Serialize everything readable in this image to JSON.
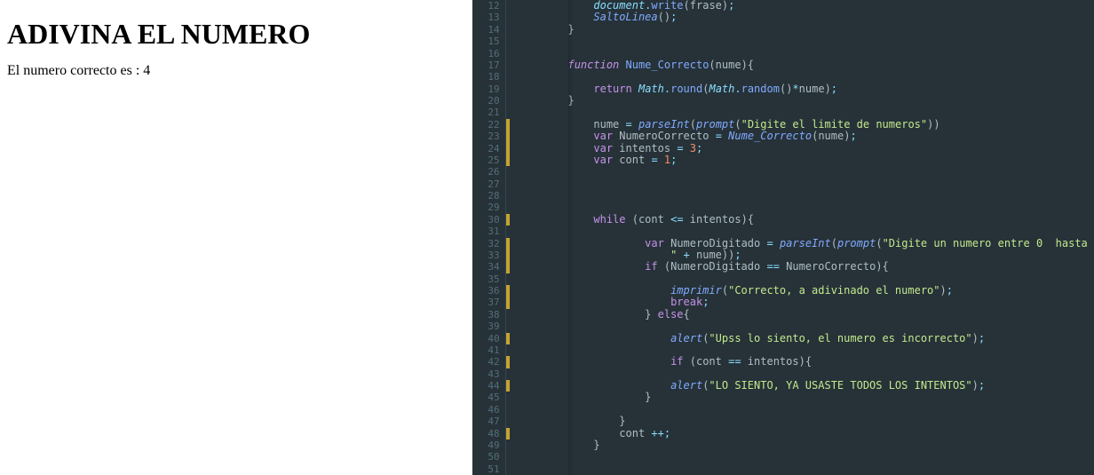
{
  "preview": {
    "heading": "ADIVINA EL NUMERO",
    "message": "El numero correcto es : 4"
  },
  "editor": {
    "first_line_number": 12,
    "modified_lines": [
      22,
      23,
      24,
      25,
      30,
      32,
      33,
      34,
      36,
      37,
      40,
      42,
      44,
      48
    ],
    "code_lines": [
      {
        "n": 12,
        "tokens": [
          [
            "            ",
            ""
          ],
          [
            "document",
            "obj"
          ],
          [
            ".",
            "op"
          ],
          [
            "write",
            "prop"
          ],
          [
            "(",
            "paren"
          ],
          [
            "frase",
            "ident"
          ],
          [
            ")",
            "paren"
          ],
          [
            ";",
            "punc"
          ]
        ]
      },
      {
        "n": 13,
        "tokens": [
          [
            "            ",
            ""
          ],
          [
            "SaltoLinea",
            "fn-it"
          ],
          [
            "()",
            "paren"
          ],
          [
            ";",
            "punc"
          ]
        ]
      },
      {
        "n": 14,
        "tokens": [
          [
            "        }",
            "ident"
          ]
        ]
      },
      {
        "n": 15,
        "tokens": [
          [
            "",
            ""
          ]
        ]
      },
      {
        "n": 16,
        "tokens": [
          [
            "",
            ""
          ]
        ]
      },
      {
        "n": 17,
        "tokens": [
          [
            "        ",
            ""
          ],
          [
            "function",
            "kw"
          ],
          [
            " ",
            ""
          ],
          [
            "Nume_Correcto",
            "fn"
          ],
          [
            "(",
            "paren"
          ],
          [
            "nume",
            "ident"
          ],
          [
            ")",
            "paren"
          ],
          [
            "{",
            "ident"
          ]
        ]
      },
      {
        "n": 18,
        "tokens": [
          [
            "",
            ""
          ]
        ]
      },
      {
        "n": 19,
        "tokens": [
          [
            "            ",
            ""
          ],
          [
            "return",
            "kw2"
          ],
          [
            " ",
            ""
          ],
          [
            "Math",
            "obj"
          ],
          [
            ".",
            "op"
          ],
          [
            "round",
            "prop"
          ],
          [
            "(",
            "paren"
          ],
          [
            "Math",
            "obj"
          ],
          [
            ".",
            "op"
          ],
          [
            "random",
            "prop"
          ],
          [
            "()",
            "paren"
          ],
          [
            "*",
            "op"
          ],
          [
            "nume",
            "ident"
          ],
          [
            ")",
            "paren"
          ],
          [
            ";",
            "punc"
          ]
        ]
      },
      {
        "n": 20,
        "tokens": [
          [
            "        }",
            "ident"
          ]
        ]
      },
      {
        "n": 21,
        "tokens": [
          [
            "",
            ""
          ]
        ]
      },
      {
        "n": 22,
        "tokens": [
          [
            "            ",
            ""
          ],
          [
            "nume",
            "ident"
          ],
          [
            " ",
            ""
          ],
          [
            "=",
            "op"
          ],
          [
            " ",
            ""
          ],
          [
            "parseInt",
            "fn-it"
          ],
          [
            "(",
            "paren"
          ],
          [
            "prompt",
            "fn-it"
          ],
          [
            "(",
            "paren"
          ],
          [
            "\"Digite el limite de numeros\"",
            "str"
          ],
          [
            "))",
            "paren"
          ]
        ]
      },
      {
        "n": 23,
        "tokens": [
          [
            "            ",
            ""
          ],
          [
            "var",
            "kw2"
          ],
          [
            " ",
            ""
          ],
          [
            "NumeroCorrecto",
            "ident"
          ],
          [
            " ",
            ""
          ],
          [
            "=",
            "op"
          ],
          [
            " ",
            ""
          ],
          [
            "Nume_Correcto",
            "fn-it"
          ],
          [
            "(",
            "paren"
          ],
          [
            "nume",
            "ident"
          ],
          [
            ")",
            "paren"
          ],
          [
            ";",
            "punc"
          ]
        ]
      },
      {
        "n": 24,
        "tokens": [
          [
            "            ",
            ""
          ],
          [
            "var",
            "kw2"
          ],
          [
            " ",
            ""
          ],
          [
            "intentos",
            "ident"
          ],
          [
            " ",
            ""
          ],
          [
            "=",
            "op"
          ],
          [
            " ",
            ""
          ],
          [
            "3",
            "num"
          ],
          [
            ";",
            "punc"
          ]
        ]
      },
      {
        "n": 25,
        "tokens": [
          [
            "            ",
            ""
          ],
          [
            "var",
            "kw2"
          ],
          [
            " ",
            ""
          ],
          [
            "cont",
            "ident"
          ],
          [
            " ",
            ""
          ],
          [
            "=",
            "op"
          ],
          [
            " ",
            ""
          ],
          [
            "1",
            "num"
          ],
          [
            ";",
            "punc"
          ]
        ]
      },
      {
        "n": 26,
        "tokens": [
          [
            "",
            ""
          ]
        ]
      },
      {
        "n": 27,
        "tokens": [
          [
            "",
            ""
          ]
        ]
      },
      {
        "n": 28,
        "tokens": [
          [
            "",
            ""
          ]
        ]
      },
      {
        "n": 29,
        "tokens": [
          [
            "",
            ""
          ]
        ]
      },
      {
        "n": 30,
        "tokens": [
          [
            "            ",
            ""
          ],
          [
            "while",
            "kw2"
          ],
          [
            " (",
            "paren"
          ],
          [
            "cont",
            "ident"
          ],
          [
            " ",
            ""
          ],
          [
            "<=",
            "op"
          ],
          [
            " ",
            ""
          ],
          [
            "intentos",
            "ident"
          ],
          [
            "){",
            "ident"
          ]
        ]
      },
      {
        "n": 31,
        "tokens": [
          [
            "",
            ""
          ]
        ]
      },
      {
        "n": 32,
        "tokens": [
          [
            "                    ",
            ""
          ],
          [
            "var",
            "kw2"
          ],
          [
            " ",
            ""
          ],
          [
            "NumeroDigitado",
            "ident"
          ],
          [
            " ",
            ""
          ],
          [
            "=",
            "op"
          ],
          [
            " ",
            ""
          ],
          [
            "parseInt",
            "fn-it"
          ],
          [
            "(",
            "paren"
          ],
          [
            "prompt",
            "fn-it"
          ],
          [
            "(",
            "paren"
          ],
          [
            "\"Digite un numero entre 0  hasta ",
            "str"
          ]
        ]
      },
      {
        "n": 33,
        "tokens": [
          [
            "                        ",
            ""
          ],
          [
            "\"",
            "str"
          ],
          [
            " ",
            ""
          ],
          [
            "+",
            "op"
          ],
          [
            " ",
            ""
          ],
          [
            "nume",
            "ident"
          ],
          [
            "))",
            "paren"
          ],
          [
            ";",
            "punc"
          ]
        ]
      },
      {
        "n": 34,
        "tokens": [
          [
            "                    ",
            ""
          ],
          [
            "if",
            "kw2"
          ],
          [
            " (",
            "paren"
          ],
          [
            "NumeroDigitado",
            "ident"
          ],
          [
            " ",
            ""
          ],
          [
            "==",
            "op"
          ],
          [
            " ",
            ""
          ],
          [
            "NumeroCorrecto",
            "ident"
          ],
          [
            "){",
            "ident"
          ]
        ]
      },
      {
        "n": 35,
        "tokens": [
          [
            "",
            ""
          ]
        ]
      },
      {
        "n": 36,
        "tokens": [
          [
            "                        ",
            ""
          ],
          [
            "imprimir",
            "fn-it"
          ],
          [
            "(",
            "paren"
          ],
          [
            "\"Correcto, a adivinado el numero\"",
            "str"
          ],
          [
            ")",
            "paren"
          ],
          [
            ";",
            "punc"
          ]
        ]
      },
      {
        "n": 37,
        "tokens": [
          [
            "                        ",
            ""
          ],
          [
            "break",
            "kw2"
          ],
          [
            ";",
            "punc"
          ]
        ]
      },
      {
        "n": 38,
        "tokens": [
          [
            "                    } ",
            "ident"
          ],
          [
            "else",
            "kw2"
          ],
          [
            "{",
            "ident"
          ]
        ]
      },
      {
        "n": 39,
        "tokens": [
          [
            "",
            ""
          ]
        ]
      },
      {
        "n": 40,
        "tokens": [
          [
            "                        ",
            ""
          ],
          [
            "alert",
            "fn-it"
          ],
          [
            "(",
            "paren"
          ],
          [
            "\"Upss lo siento, el numero es incorrecto\"",
            "str"
          ],
          [
            ")",
            "paren"
          ],
          [
            ";",
            "punc"
          ]
        ]
      },
      {
        "n": 41,
        "tokens": [
          [
            "",
            ""
          ]
        ]
      },
      {
        "n": 42,
        "tokens": [
          [
            "                        ",
            ""
          ],
          [
            "if",
            "kw2"
          ],
          [
            " (",
            "paren"
          ],
          [
            "cont",
            "ident"
          ],
          [
            " ",
            ""
          ],
          [
            "==",
            "op"
          ],
          [
            " ",
            ""
          ],
          [
            "intentos",
            "ident"
          ],
          [
            "){",
            "ident"
          ]
        ]
      },
      {
        "n": 43,
        "tokens": [
          [
            "",
            ""
          ]
        ]
      },
      {
        "n": 44,
        "tokens": [
          [
            "                        ",
            ""
          ],
          [
            "alert",
            "fn-it"
          ],
          [
            "(",
            "paren"
          ],
          [
            "\"LO SIENTO, YA USASTE TODOS LOS INTENTOS\"",
            "str"
          ],
          [
            ")",
            "paren"
          ],
          [
            ";",
            "punc"
          ]
        ]
      },
      {
        "n": 45,
        "tokens": [
          [
            "                    }",
            "ident"
          ]
        ]
      },
      {
        "n": 46,
        "tokens": [
          [
            "",
            ""
          ]
        ]
      },
      {
        "n": 47,
        "tokens": [
          [
            "                }",
            "ident"
          ]
        ]
      },
      {
        "n": 48,
        "tokens": [
          [
            "                ",
            ""
          ],
          [
            "cont",
            "ident"
          ],
          [
            " ",
            ""
          ],
          [
            "++",
            "op"
          ],
          [
            ";",
            "punc"
          ]
        ]
      },
      {
        "n": 49,
        "tokens": [
          [
            "            }",
            "ident"
          ]
        ]
      },
      {
        "n": 50,
        "tokens": [
          [
            "",
            ""
          ]
        ]
      },
      {
        "n": 51,
        "tokens": [
          [
            "",
            ""
          ]
        ]
      }
    ]
  }
}
